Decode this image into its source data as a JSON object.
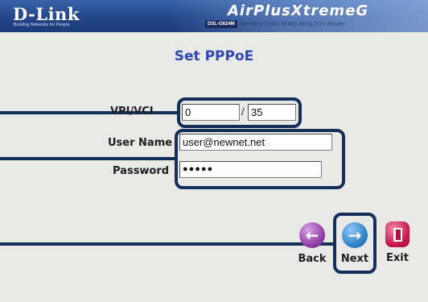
{
  "header": {
    "brand": "D-Link",
    "brand_tagline": "Building Networks for People",
    "product_logo": "AirPlusXtremeG",
    "model_badge": "DSL-G624M",
    "model_description": "Wireless 108G MIMO ADSL2/2+ Router",
    "colors": {
      "banner": "#23468a",
      "title": "#2e49b3",
      "callout": "#14305a"
    }
  },
  "page_title": "Set PPPoE",
  "form": {
    "vpi_vci_label": "VPI/VCI",
    "vpi_value": "0",
    "vci_value": "35",
    "separator": "/",
    "username_label": "User Name",
    "username_value": "user@newnet.net",
    "password_label": "Password",
    "password_value": "●●●●●"
  },
  "nav": {
    "back_label": "Back",
    "back_icon": "arrow-left-icon",
    "next_label": "Next",
    "next_icon": "arrow-right-icon",
    "exit_label": "Exit",
    "exit_icon": "door-exit-icon"
  }
}
